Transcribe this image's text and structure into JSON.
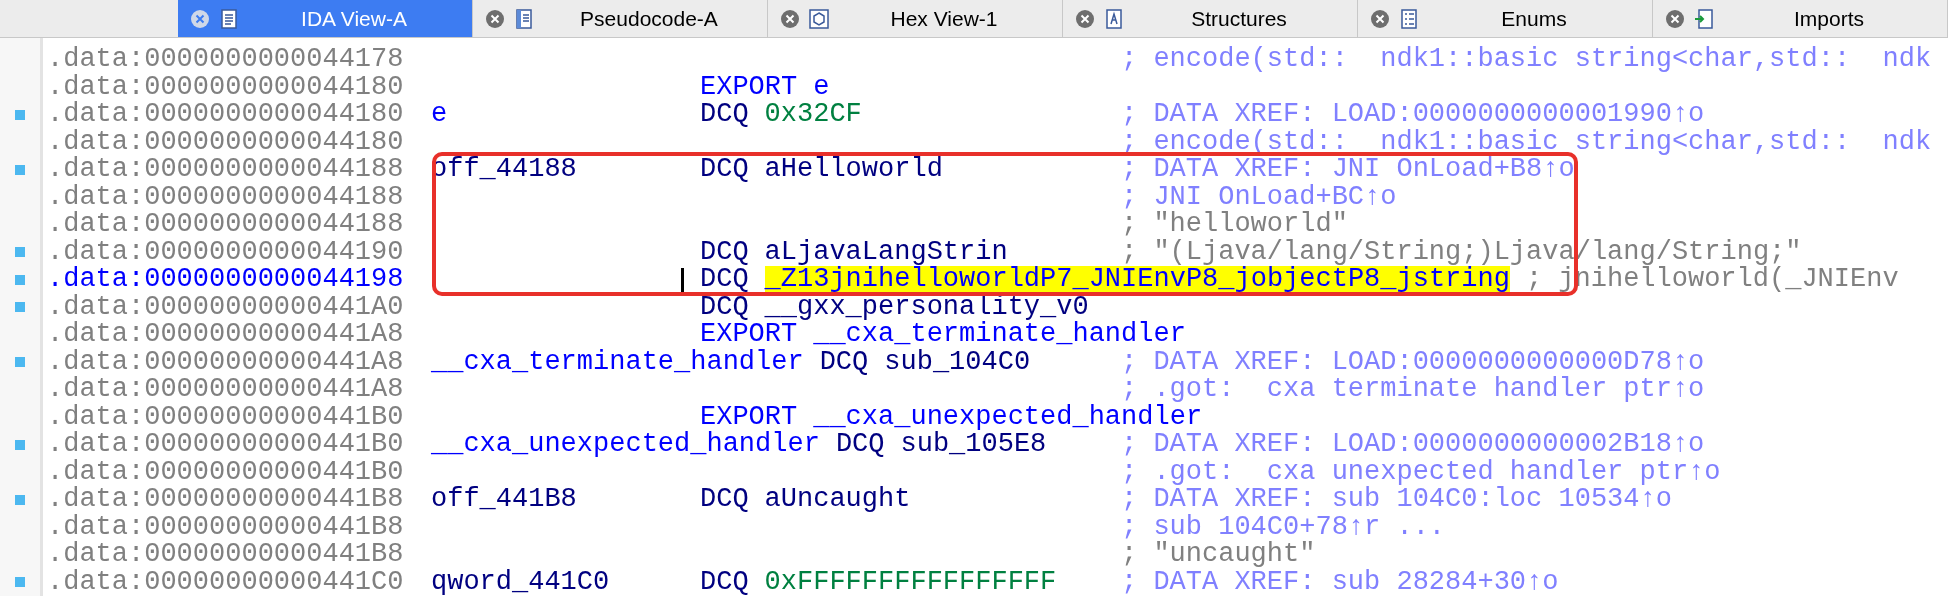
{
  "tabs": [
    {
      "label": "IDA View-A",
      "selected": true
    },
    {
      "label": "Pseudocode-A",
      "selected": false
    },
    {
      "label": "Hex View-1",
      "selected": false
    },
    {
      "label": "Structures",
      "selected": false
    },
    {
      "label": "Enums",
      "selected": false
    },
    {
      "label": "Imports",
      "selected": false
    }
  ],
  "listing": [
    {
      "address": ".data:0000000000044178",
      "selected": false,
      "marked": false,
      "comment": {
        "text": "; encode(std::  ndk1::basic string<char,std::  ndk",
        "kind": "xref"
      }
    },
    {
      "address": ".data:0000000000044180",
      "selected": false,
      "marked": false,
      "instruction": {
        "mnemonic": "EXPORT",
        "operand": "e",
        "kind": "directive"
      }
    },
    {
      "address": ".data:0000000000044180",
      "selected": false,
      "marked": true,
      "label": {
        "text": "e",
        "kind": "public"
      },
      "instruction": {
        "mnemonic": "DCQ",
        "operand": "0x32CF",
        "kind": "number"
      },
      "comment": {
        "text": "; DATA XREF: LOAD:0000000000001990↑o",
        "kind": "xref"
      }
    },
    {
      "address": ".data:0000000000044180",
      "selected": false,
      "marked": false,
      "comment": {
        "text": "; encode(std::  ndk1::basic string<char,std::  ndk",
        "kind": "xref"
      }
    },
    {
      "address": ".data:0000000000044188",
      "selected": false,
      "marked": true,
      "label": {
        "text": "off_44188",
        "kind": "local"
      },
      "instruction": {
        "mnemonic": "DCQ",
        "operand": "aHelloworld",
        "kind": "name"
      },
      "comment": {
        "text": "; DATA XREF: JNI OnLoad+B8↑o",
        "kind": "xref"
      }
    },
    {
      "address": ".data:0000000000044188",
      "selected": false,
      "marked": false,
      "comment": {
        "text": "; JNI OnLoad+BC↑o",
        "kind": "xref"
      }
    },
    {
      "address": ".data:0000000000044188",
      "selected": false,
      "marked": false,
      "comment": {
        "text": "; \"helloworld\"",
        "kind": "string"
      }
    },
    {
      "address": ".data:0000000000044190",
      "selected": false,
      "marked": true,
      "instruction": {
        "mnemonic": "DCQ",
        "operand": "aLjavaLangStrin",
        "kind": "name"
      },
      "comment": {
        "text": "; \"(Ljava/lang/String;)Ljava/lang/String;\"",
        "kind": "string"
      }
    },
    {
      "address": ".data:0000000000044198",
      "selected": true,
      "marked": true,
      "cursor": true,
      "instruction": {
        "mnemonic": "DCQ",
        "operand": "_Z13jnihelloworldP7_JNIEnvP8_jobjectP8_jstring",
        "kind": "highlighted"
      },
      "comment": {
        "text": "; jnihelloworld(_JNIEnv",
        "kind": "string"
      }
    },
    {
      "address": ".data:00000000000441A0",
      "selected": false,
      "marked": true,
      "instruction": {
        "mnemonic": "DCQ",
        "operand": "__gxx_personality_v0",
        "kind": "name"
      }
    },
    {
      "address": ".data:00000000000441A8",
      "selected": false,
      "marked": false,
      "instruction": {
        "mnemonic": "EXPORT",
        "operand": "__cxa_terminate_handler",
        "kind": "directive"
      }
    },
    {
      "address": ".data:00000000000441A8",
      "selected": false,
      "marked": true,
      "label": {
        "text": "__cxa_terminate_handler",
        "kind": "public"
      },
      "instruction": {
        "mnemonic": "DCQ",
        "operand": "sub_104C0",
        "kind": "name"
      },
      "comment": {
        "text": "; DATA XREF: LOAD:0000000000000D78↑o",
        "kind": "xref"
      }
    },
    {
      "address": ".data:00000000000441A8",
      "selected": false,
      "marked": false,
      "comment": {
        "text": "; .got:  cxa terminate handler ptr↑o",
        "kind": "xref"
      }
    },
    {
      "address": ".data:00000000000441B0",
      "selected": false,
      "marked": false,
      "instruction": {
        "mnemonic": "EXPORT",
        "operand": "__cxa_unexpected_handler",
        "kind": "directive"
      }
    },
    {
      "address": ".data:00000000000441B0",
      "selected": false,
      "marked": true,
      "label": {
        "text": "__cxa_unexpected_handler",
        "kind": "public"
      },
      "instruction": {
        "mnemonic": "DCQ",
        "operand": "sub_105E8",
        "kind": "name"
      },
      "comment": {
        "text": "; DATA XREF: LOAD:0000000000002B18↑o",
        "kind": "xref"
      }
    },
    {
      "address": ".data:00000000000441B0",
      "selected": false,
      "marked": false,
      "comment": {
        "text": "; .got:  cxa unexpected handler ptr↑o",
        "kind": "xref"
      }
    },
    {
      "address": ".data:00000000000441B8",
      "selected": false,
      "marked": true,
      "label": {
        "text": "off_441B8",
        "kind": "local"
      },
      "instruction": {
        "mnemonic": "DCQ",
        "operand": "aUncaught",
        "kind": "name"
      },
      "comment": {
        "text": "; DATA XREF: sub 104C0:loc 10534↑o",
        "kind": "xref"
      }
    },
    {
      "address": ".data:00000000000441B8",
      "selected": false,
      "marked": false,
      "comment": {
        "text": "; sub 104C0+78↑r ...",
        "kind": "xref"
      }
    },
    {
      "address": ".data:00000000000441B8",
      "selected": false,
      "marked": false,
      "comment": {
        "text": "; \"uncaught\"",
        "kind": "string"
      }
    },
    {
      "address": ".data:00000000000441C0",
      "selected": false,
      "marked": true,
      "label": {
        "text": "qword_441C0",
        "kind": "local"
      },
      "instruction": {
        "mnemonic": "DCQ",
        "operand": "0xFFFFFFFFFFFFFFFF",
        "kind": "number"
      },
      "comment": {
        "text": "; DATA XREF: sub 28284+30↑o",
        "kind": "xref"
      }
    }
  ]
}
